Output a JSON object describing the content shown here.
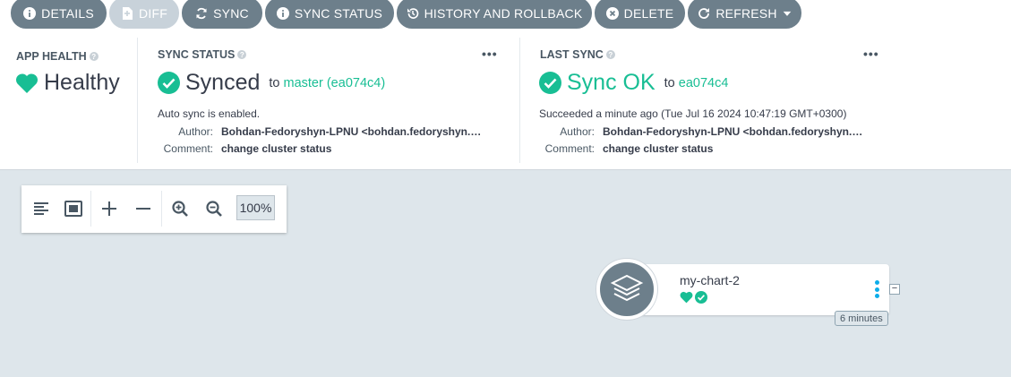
{
  "toolbar": {
    "details": "DETAILS",
    "diff": "DIFF",
    "sync": "SYNC",
    "sync_status": "SYNC STATUS",
    "history": "HISTORY AND ROLLBACK",
    "delete": "DELETE",
    "refresh": "REFRESH"
  },
  "app_health": {
    "label": "APP HEALTH",
    "value": "Healthy",
    "color": "#18be94"
  },
  "sync_status": {
    "label": "SYNC STATUS",
    "value": "Synced",
    "to_word": "to",
    "target": "master (ea074c4)",
    "auto_sync": "Auto sync is enabled.",
    "author_key": "Author:",
    "author": "Bohdan-Fedoryshyn-LPNU <bohdan.fedoryshyn.mitp…",
    "comment_key": "Comment:",
    "comment": "change cluster status",
    "menu": "•••"
  },
  "last_sync": {
    "label": "LAST SYNC",
    "value": "Sync OK",
    "to_word": "to",
    "target": "ea074c4",
    "succeeded": "Succeeded a minute ago (Tue Jul 16 2024 10:47:19 GMT+0300)",
    "author_key": "Author:",
    "author": "Bohdan-Fedoryshyn-LPNU <bohdan.fedoryshyn.mitp…",
    "comment_key": "Comment:",
    "comment": "change cluster status",
    "menu": "•••"
  },
  "graph": {
    "zoom": "100%",
    "node": {
      "name": "my-chart-2",
      "age": "6 minutes",
      "collapse": "−"
    }
  },
  "colors": {
    "accent": "#18be94",
    "button": "#6d7f8b",
    "button_disabled": "#c8d2da",
    "kebab": "#0dadea"
  }
}
